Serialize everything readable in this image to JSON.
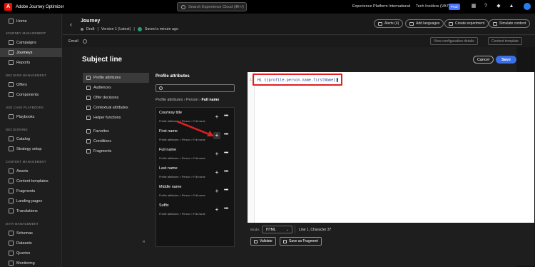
{
  "topbar": {
    "app_title": "Adobe Journey Optimizer",
    "search_placeholder": "Search Experience Cloud (⌘+/)",
    "org": "Experience Platform International",
    "sandbox": "Tech Insiders (VA7)",
    "sandbox_badge": "Prod"
  },
  "sidebar": {
    "items": [
      {
        "label": "Home",
        "icon": "home-icon"
      },
      {
        "label": "Campaigns",
        "icon": "campaign-icon"
      },
      {
        "label": "Journeys",
        "icon": "journey-icon"
      },
      {
        "label": "Reports",
        "icon": "report-icon"
      },
      {
        "label": "Offers",
        "icon": "offer-icon"
      },
      {
        "label": "Components",
        "icon": "components-icon"
      },
      {
        "label": "Playbooks",
        "icon": "playbook-icon"
      },
      {
        "label": "Catalog",
        "icon": "catalog-icon"
      },
      {
        "label": "Strategy setup",
        "icon": "strategy-icon"
      },
      {
        "label": "Assets",
        "icon": "assets-icon"
      },
      {
        "label": "Content templates",
        "icon": "template-icon"
      },
      {
        "label": "Fragments",
        "icon": "fragment-icon"
      },
      {
        "label": "Landing pages",
        "icon": "landing-page-icon"
      },
      {
        "label": "Translations",
        "icon": "translation-icon"
      },
      {
        "label": "Schemas",
        "icon": "schema-icon"
      },
      {
        "label": "Datasets",
        "icon": "dataset-icon"
      },
      {
        "label": "Queries",
        "icon": "query-icon"
      },
      {
        "label": "Monitoring",
        "icon": "monitoring-icon"
      }
    ],
    "sections": [
      "JOURNEY MANAGEMENT",
      "DECISION MANAGEMENT",
      "USE CASE PLAYBOOKS",
      "DECISIONING",
      "CONTENT MANAGEMENT",
      "DATA MANAGEMENT"
    ]
  },
  "journey": {
    "title": "Journey",
    "status": "Draft",
    "version": "Version 1 (Latest)",
    "saved": "Saved a minute ago",
    "alerts": "Alerts (4)",
    "add_languages": "Add languages",
    "create_experiment": "Create experiment",
    "simulate_content": "Simulate content"
  },
  "email_strip": {
    "label": "Email",
    "view_config": "View configuration details",
    "content_template": "Content template"
  },
  "modal": {
    "title": "Subject line",
    "cancel": "Cancel",
    "save": "Save",
    "categories": [
      "Profile attributes",
      "Audiences",
      "Offer decisions",
      "Contextual attributes",
      "Helper functions",
      "Favorites",
      "Conditions",
      "Fragments"
    ],
    "attributes": {
      "title": "Profile attributes",
      "breadcrumb": [
        "Profile attributes",
        "Person",
        "Full name"
      ],
      "fields": [
        {
          "name": "Courtesy title",
          "path": "Profile attributes > Person > Full name"
        },
        {
          "name": "First name",
          "path": "Profile attributes > Person > Full name"
        },
        {
          "name": "Full name",
          "path": "Profile attributes > Person > Full name"
        },
        {
          "name": "Last name",
          "path": "Profile attributes > Person > Full name"
        },
        {
          "name": "Middle name",
          "path": "Profile attributes > Person > Full name"
        },
        {
          "name": "Suffix",
          "path": "Profile attributes > Person > Full name"
        }
      ]
    },
    "editor": {
      "line_number": "1",
      "code": "Hi {{profile.person.name.firstName}}",
      "mode_label": "Mode:",
      "mode": "HTML",
      "status": "Line 1, Character 37",
      "validate": "Validate",
      "save_fragment": "Save as Fragment"
    }
  },
  "colors": {
    "accent": "#3a6fe8",
    "annotation": "#e02020",
    "brand": "#eb1000"
  }
}
